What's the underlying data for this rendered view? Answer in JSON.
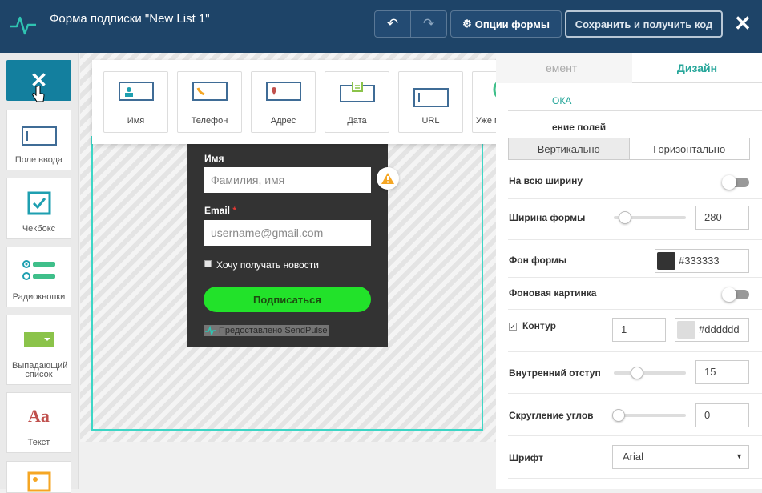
{
  "header": {
    "title": "Форма подписки \"New List 1\"",
    "undo": "↶",
    "redo": "↷",
    "options_label": "Опции формы",
    "save_label": "Сохранить и получить код",
    "close": "✕"
  },
  "toolbox": {
    "close": "✕",
    "items": [
      {
        "label": "Поле ввода"
      },
      {
        "label": "Чекбокс"
      },
      {
        "label": "Радиокнопки"
      },
      {
        "label": "Выпадающий список"
      },
      {
        "label": "Текст"
      }
    ]
  },
  "field_popup": {
    "items": [
      {
        "label": "Имя"
      },
      {
        "label": "Телефон"
      },
      {
        "label": "Адрес"
      },
      {
        "label": "Дата"
      },
      {
        "label": "URL"
      },
      {
        "label": "Уже подписан"
      }
    ]
  },
  "form": {
    "name_label": "Имя",
    "name_placeholder": "Фамилия, имя",
    "email_label": "Email",
    "required_mark": "*",
    "email_placeholder": "username@gmail.com",
    "checkbox_label": "Хочу получать новости",
    "submit_label": "Подписаться",
    "powered_by": "Предоставлено SendPulse",
    "background": "#333333",
    "button_color": "#22e22a"
  },
  "panel": {
    "tabs": [
      {
        "label": "емент"
      },
      {
        "label": "Дизайн"
      }
    ],
    "section": "ОКА",
    "subheading": "ение полей",
    "layout_options": [
      {
        "label": "Вертикально",
        "active": true
      },
      {
        "label": "Горизонтально",
        "active": false
      }
    ],
    "full_width": {
      "label": "На всю ширину",
      "on": false
    },
    "form_width": {
      "label": "Ширина формы",
      "value": "280"
    },
    "form_bg": {
      "label": "Фон формы",
      "value": "#333333"
    },
    "bg_image": {
      "label": "Фоновая картинка",
      "on": false
    },
    "border": {
      "label": "Контур",
      "width": "1",
      "color": "#dddddd",
      "checked": true
    },
    "padding": {
      "label": "Внутренний отступ",
      "value": "15"
    },
    "radius": {
      "label": "Скругление углов",
      "value": "0"
    },
    "font": {
      "label": "Шрифт",
      "value": "Arial"
    }
  },
  "colors": {
    "header": "#1e4468",
    "accent": "#26a69a",
    "tool_close": "#137f9e"
  }
}
